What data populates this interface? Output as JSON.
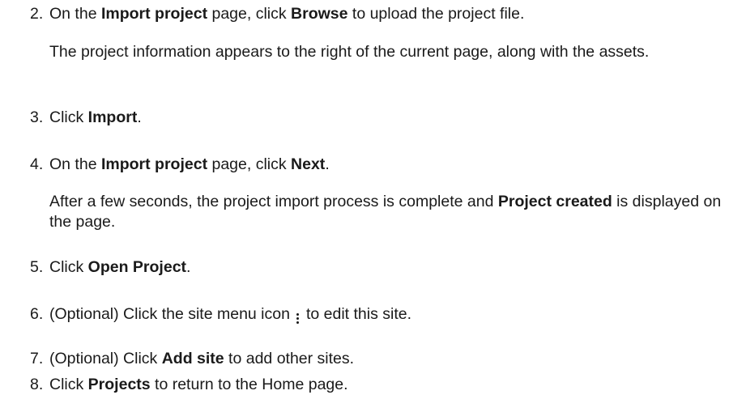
{
  "steps": [
    {
      "number": "2.",
      "parts": [
        "On the ",
        "Import project",
        " page, click ",
        "Browse",
        " to upload the project file."
      ],
      "note": "The project information appears to the right of the current page, along with the assets."
    },
    {
      "number": "3.",
      "parts": [
        "Click ",
        "Import",
        "."
      ]
    },
    {
      "number": "4.",
      "parts": [
        "On the ",
        "Import project",
        " page, click ",
        "Next",
        "."
      ],
      "note_parts": [
        "After a few seconds, the project import process is complete and ",
        "Project created",
        " is displayed on the page."
      ]
    },
    {
      "number": "5.",
      "parts": [
        "Click ",
        "Open Project",
        "."
      ]
    },
    {
      "number": "6.",
      "parts": [
        "(Optional) Click the site menu icon",
        "to edit this site."
      ],
      "icon": "kebab-menu-icon"
    },
    {
      "number": "7.",
      "parts": [
        "(Optional) Click ",
        "Add site",
        " to add other sites."
      ]
    },
    {
      "number": "8.",
      "parts": [
        "Click ",
        "Projects",
        " to return to the Home page."
      ]
    }
  ]
}
